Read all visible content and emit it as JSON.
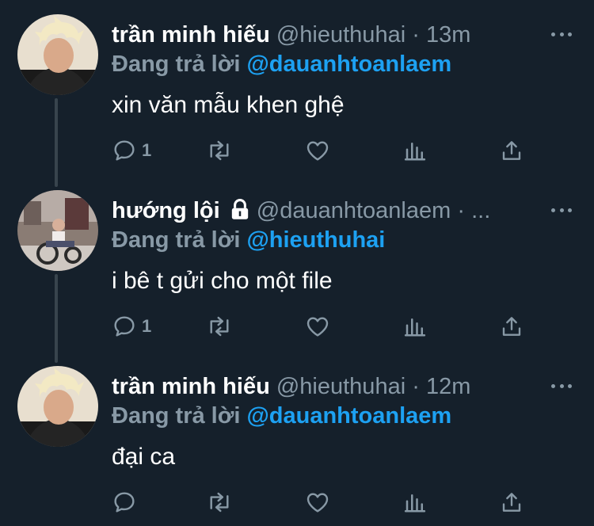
{
  "tweets": [
    {
      "name": "trần minh hiếu",
      "handle": "@hieuthuhai",
      "separator": "·",
      "time": "13m",
      "reply_label": "Đang trả lời",
      "reply_to": "@dauanhtoanlaem",
      "text": "xin văn mẫu khen ghệ",
      "reply_count": "1",
      "avatar": "blond-man-avatar"
    },
    {
      "name": "hướng lội",
      "handle": "@dauanhtoanlaem",
      "separator": "·",
      "time": "...",
      "reply_label": "Đang trả lời",
      "reply_to": "@hieuthuhai",
      "text": "i bê t gửi cho một file",
      "reply_count": "1",
      "protected": true,
      "avatar": "child-on-tricycle-avatar"
    },
    {
      "name": "trần minh hiếu",
      "handle": "@hieuthuhai",
      "separator": "·",
      "time": "12m",
      "reply_label": "Đang trả lời",
      "reply_to": "@dauanhtoanlaem",
      "text": "đại ca",
      "reply_count": "",
      "avatar": "blond-man-avatar"
    }
  ],
  "colors": {
    "background": "#15202b",
    "secondary_text": "#8899a6",
    "link": "#1da1f2",
    "thread_line": "#38444d"
  },
  "icons": [
    "reply-icon",
    "retweet-icon",
    "like-icon",
    "analytics-icon",
    "share-icon",
    "more-icon",
    "lock-icon"
  ]
}
